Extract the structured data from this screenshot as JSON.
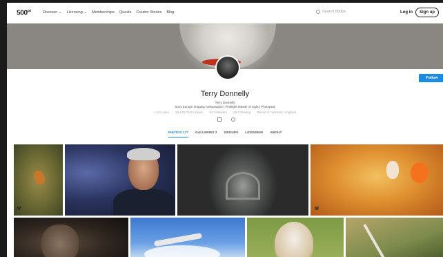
{
  "nav": {
    "logo": "500",
    "logo_sup": "px",
    "menu": [
      "Discover ⌄",
      "Licensing ⌄",
      "Memberships",
      "Quests",
      "Creator Stories",
      "Blog"
    ],
    "search_placeholder": "Search 500px",
    "login": "Log in",
    "signup": "Sign up"
  },
  "profile": {
    "follow": "Follow",
    "name": "Terry Donnelly",
    "line1": "Terry Donnelly",
    "line2": "Sony Europe Imaging Ambassador | Firstlight Master of Light | Photopedi",
    "stats": [
      "1.1m Likes",
      "18,148 Photo Views",
      "94 Followers",
      "29 Following",
      "Based in Yorkshire, England"
    ],
    "tabs": [
      "PHOTOS 177",
      "GALLERIES 2",
      "GROUPS",
      "LICENSING",
      "ABOUT"
    ]
  },
  "photo_signature": "M"
}
